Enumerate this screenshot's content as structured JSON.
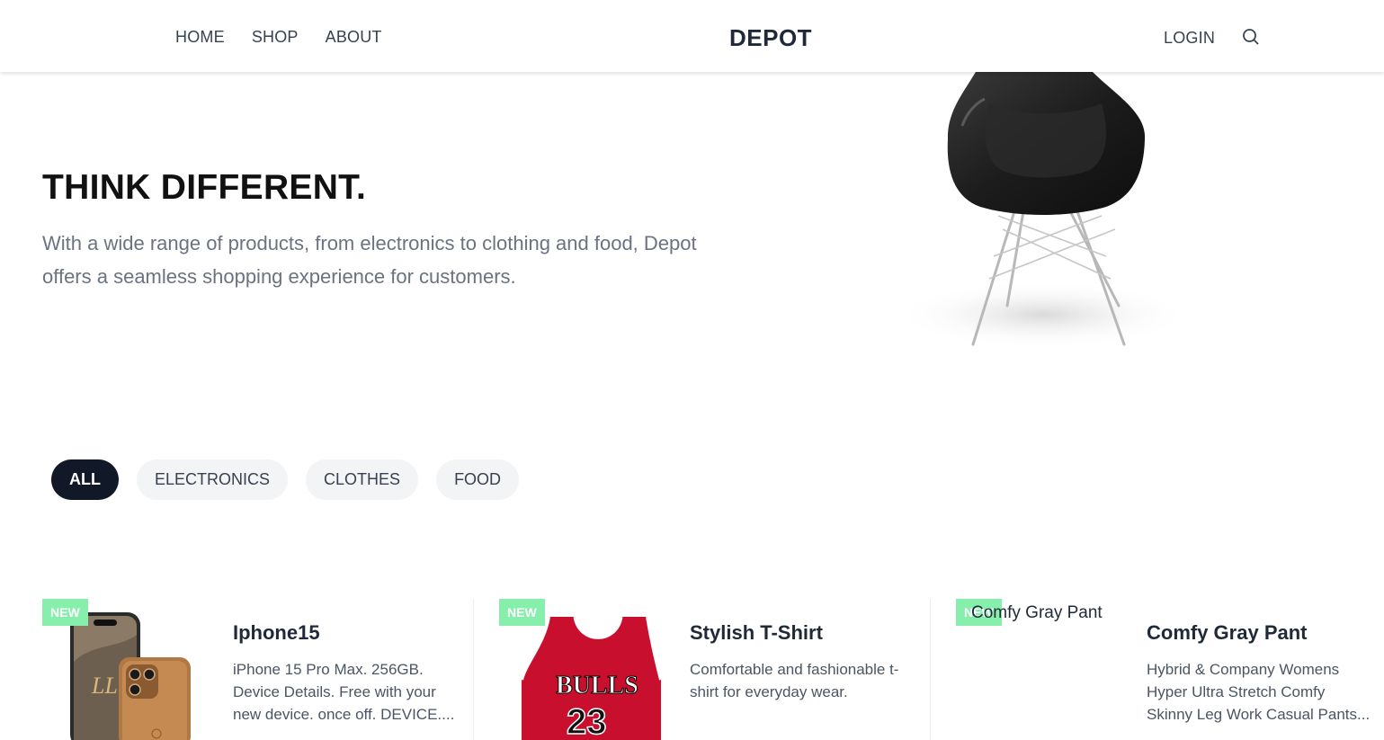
{
  "nav": {
    "links": [
      "HOME",
      "SHOP",
      "ABOUT"
    ],
    "brand": "DEPOT",
    "login": "LOGIN",
    "search_icon": "search-icon"
  },
  "hero": {
    "title": "THINK DIFFERENT.",
    "subtitle": "With a wide range of products, from electronics to clothing and food, Depot offers a seamless shopping experience for customers.",
    "image": "chair-image"
  },
  "filters": {
    "items": [
      "ALL",
      "ELECTRONICS",
      "CLOTHES",
      "FOOD"
    ],
    "active": "ALL"
  },
  "products": [
    {
      "badge": "NEW",
      "title": "Iphone15",
      "description": "iPhone 15 Pro Max. 256GB. Device Details. Free with your new device. once off. DEVICE....",
      "image": "iphone-image"
    },
    {
      "badge": "NEW",
      "title": "Stylish T-Shirt",
      "description": "Comfortable and fashionable t-shirt for everyday wear.",
      "image": "jersey-image"
    },
    {
      "badge": "NEW",
      "title": "Comfy Gray Pant",
      "description": "Hybrid & Company Womens Hyper Ultra Stretch Comfy Skinny Leg Work Casual Pants...",
      "image_alt": "Comfy Gray Pant"
    }
  ],
  "colors": {
    "badge": "#86efac",
    "active_pill": "#111827",
    "pill": "#f3f4f6"
  }
}
